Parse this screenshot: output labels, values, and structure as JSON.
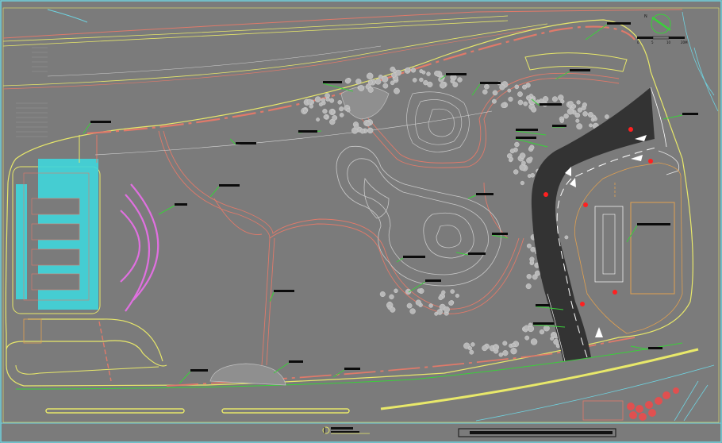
{
  "drawing": {
    "type": "CAD site plan (park / landscape layout)",
    "palette": {
      "background": "#7b7b7b",
      "frame": "#6fd3e0",
      "boundary_yellow": "#e8e86a",
      "path_red": "#e07a6a",
      "leader_green": "#3ad03a",
      "label_black": "#0b0b0b",
      "pond_line": "#c8c8c8",
      "hatch_cyan": "#45e0e8",
      "accent_magenta": "#e070e0",
      "tree_grey": "#b8b8b8",
      "road_dark": "#303030",
      "marker_red": "#ff2020",
      "orange_court": "#e0a050"
    },
    "icons": [
      "north-arrow-icon",
      "scale-bar-icon",
      "section-marker-icon"
    ],
    "leader_count": 27,
    "tree_clusters": 14,
    "title_block": {
      "has_title_bar": true
    }
  }
}
